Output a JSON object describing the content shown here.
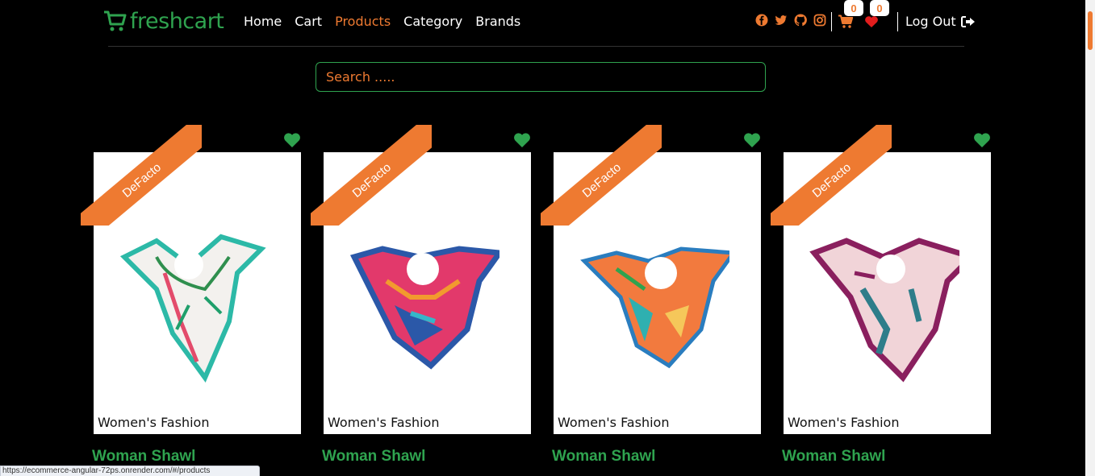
{
  "brand": {
    "name": "freshcart",
    "color": "#2fa34f"
  },
  "nav": {
    "links": [
      {
        "label": "Home"
      },
      {
        "label": "Cart"
      },
      {
        "label": "Products",
        "active": true
      },
      {
        "label": "Category"
      },
      {
        "label": "Brands"
      }
    ]
  },
  "social": [
    "facebook-icon",
    "twitter-icon",
    "github-icon",
    "instagram-icon"
  ],
  "cart": {
    "count": "0"
  },
  "wishlist": {
    "count": "0"
  },
  "logout": {
    "label": "Log Out"
  },
  "search": {
    "placeholder": "Search ....."
  },
  "products": [
    {
      "brand": "DeFacto",
      "category": "Women's Fashion",
      "title": "Woman Shawl"
    },
    {
      "brand": "DeFacto",
      "category": "Women's Fashion",
      "title": "Woman Shawl"
    },
    {
      "brand": "DeFacto",
      "category": "Women's Fashion",
      "title": "Woman Shawl"
    },
    {
      "brand": "DeFacto",
      "category": "Women's Fashion",
      "title": "Woman Shawl"
    }
  ],
  "status_bar": {
    "url": "https://ecommerce-angular-72ps.onrender.com/#/products"
  },
  "colors": {
    "accent": "#ee7a31",
    "green": "#2fa34f",
    "heart_red": "#e21d1d"
  }
}
